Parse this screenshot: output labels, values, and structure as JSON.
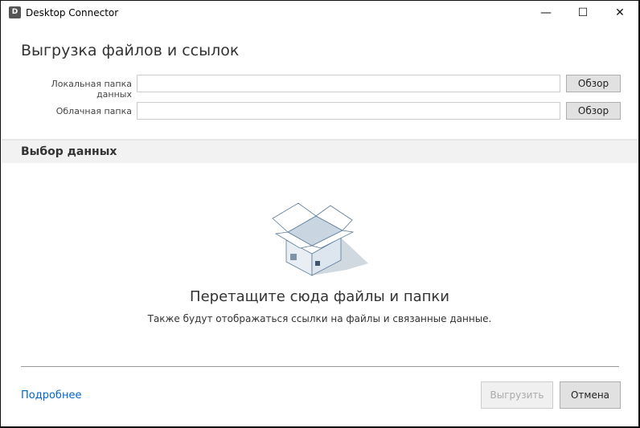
{
  "window": {
    "title": "Desktop Connector",
    "app_icon_letter": "D",
    "minimize": "—",
    "maximize": "☐",
    "close": "✕"
  },
  "header": {
    "title": "Выгрузка файлов и ссылок"
  },
  "fields": {
    "local_label": "Локальная папка данных",
    "local_value": "",
    "local_browse": "Обзор",
    "cloud_label": "Облачная папка",
    "cloud_value": "",
    "cloud_browse": "Обзор"
  },
  "section": {
    "title": "Выбор данных"
  },
  "dropzone": {
    "icon": "open-box-icon",
    "title": "Перетащите сюда файлы и папки",
    "subtitle": "Также будут отображаться ссылки на файлы и связанные данные."
  },
  "footer": {
    "more_link": "Подробнее",
    "upload": "Выгрузить",
    "cancel": "Отмена"
  }
}
